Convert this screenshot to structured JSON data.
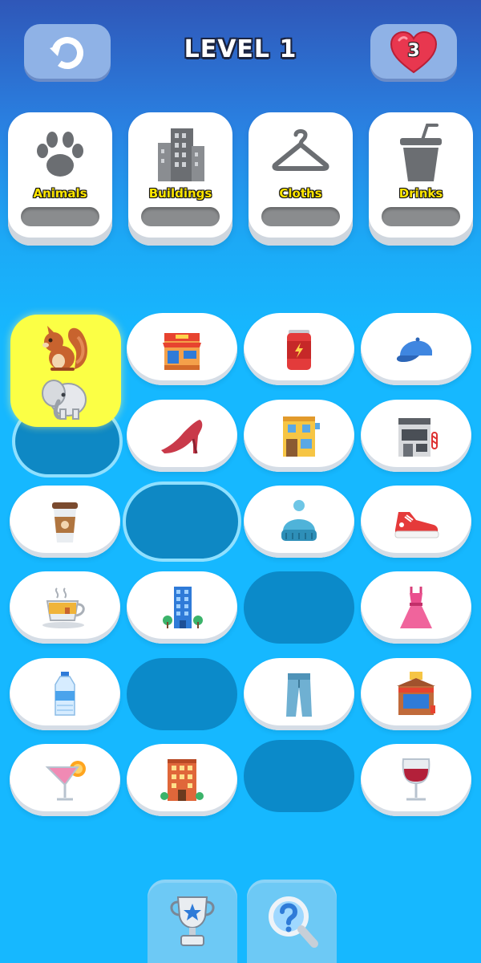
{
  "header": {
    "level_title": "LEVEL 1",
    "lives": "3",
    "restart_icon": "restart-arrow-icon",
    "heart_icon": "heart-icon"
  },
  "categories": [
    {
      "label": "Animals",
      "icon": "paw-icon",
      "progress": 0
    },
    {
      "label": "Buildings",
      "icon": "building-icon",
      "progress": 0
    },
    {
      "label": "Cloths",
      "icon": "hanger-icon",
      "progress": 0
    },
    {
      "label": "Drinks",
      "icon": "drink-cup-icon",
      "progress": 0
    }
  ],
  "board": {
    "columns": 4,
    "rows": 6,
    "tiles": [
      {
        "row": 1,
        "col": 1,
        "item": "squirrel-and-elephant",
        "state": "lifted"
      },
      {
        "row": 1,
        "col": 2,
        "item": "shop-building"
      },
      {
        "row": 1,
        "col": 3,
        "item": "energy-drink-can"
      },
      {
        "row": 1,
        "col": 4,
        "item": "baseball-cap"
      },
      {
        "row": 2,
        "col": 1,
        "item": "empty",
        "state": "highlighted"
      },
      {
        "row": 2,
        "col": 2,
        "item": "high-heel-shoe"
      },
      {
        "row": 2,
        "col": 3,
        "item": "yellow-building"
      },
      {
        "row": 2,
        "col": 4,
        "item": "barber-shop"
      },
      {
        "row": 3,
        "col": 1,
        "item": "coffee-cup"
      },
      {
        "row": 3,
        "col": 2,
        "item": "empty",
        "state": "highlighted"
      },
      {
        "row": 3,
        "col": 3,
        "item": "knit-beanie"
      },
      {
        "row": 3,
        "col": 4,
        "item": "sneaker"
      },
      {
        "row": 4,
        "col": 1,
        "item": "tea-cup"
      },
      {
        "row": 4,
        "col": 2,
        "item": "office-tower"
      },
      {
        "row": 4,
        "col": 3,
        "item": "empty"
      },
      {
        "row": 4,
        "col": 4,
        "item": "dress"
      },
      {
        "row": 5,
        "col": 1,
        "item": "water-bottle"
      },
      {
        "row": 5,
        "col": 2,
        "item": "empty"
      },
      {
        "row": 5,
        "col": 3,
        "item": "jeans"
      },
      {
        "row": 5,
        "col": 4,
        "item": "post-office"
      },
      {
        "row": 6,
        "col": 1,
        "item": "juice-glass"
      },
      {
        "row": 6,
        "col": 2,
        "item": "apartment-building"
      },
      {
        "row": 6,
        "col": 3,
        "item": "empty"
      },
      {
        "row": 6,
        "col": 4,
        "item": "wine-glass"
      }
    ]
  },
  "footer": {
    "buttons": [
      {
        "icon": "trophy-icon"
      },
      {
        "icon": "magnifier-hint-icon"
      }
    ]
  },
  "colors": {
    "accent_yellow": "#fbff45",
    "label_yellow": "#ffe600",
    "background_blue": "#16b8ff",
    "empty_slot": "#0b8ac9"
  }
}
